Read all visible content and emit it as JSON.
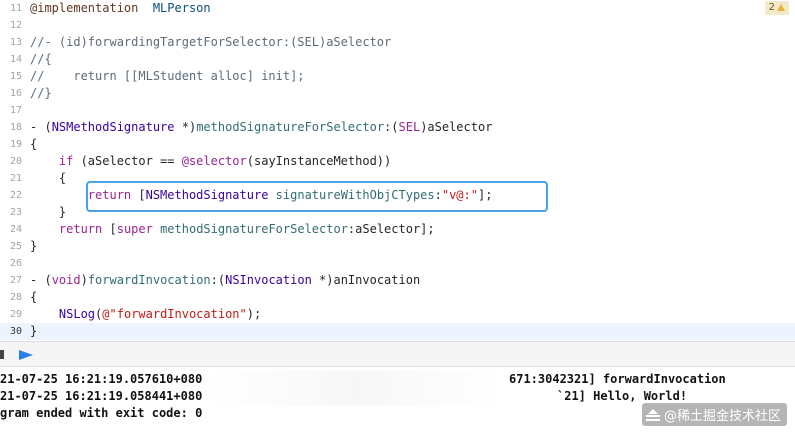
{
  "editor": {
    "issue_badge": "2",
    "lines": [
      {
        "num": "11",
        "tokens": [
          [
            "dir",
            "@implementation"
          ],
          [
            "",
            ""
          ],
          [
            "",
            "  "
          ],
          [
            "cls",
            "MLPerson"
          ]
        ]
      },
      {
        "num": "12",
        "tokens": []
      },
      {
        "num": "13",
        "tokens": [
          [
            "cmt",
            "//- (id)forwardingTargetForSelector:(SEL)aSelector"
          ]
        ]
      },
      {
        "num": "14",
        "tokens": [
          [
            "cmt",
            "//{"
          ]
        ]
      },
      {
        "num": "15",
        "tokens": [
          [
            "cmt",
            "//    return [[MLStudent alloc] init];"
          ]
        ]
      },
      {
        "num": "16",
        "tokens": [
          [
            "cmt",
            "//}"
          ]
        ]
      },
      {
        "num": "17",
        "tokens": []
      },
      {
        "num": "18",
        "tokens": [
          [
            "",
            "- ("
          ],
          [
            "ty",
            "NSMethodSignature"
          ],
          [
            "",
            " *)"
          ],
          [
            "fn",
            "methodSignatureForSelector"
          ],
          [
            "",
            ":("
          ],
          [
            "kw",
            "SEL"
          ],
          [
            "",
            ")aSelector"
          ]
        ]
      },
      {
        "num": "19",
        "tokens": [
          [
            "",
            "{"
          ]
        ]
      },
      {
        "num": "20",
        "tokens": [
          [
            "",
            "    "
          ],
          [
            "kw",
            "if"
          ],
          [
            "",
            " (aSelector == "
          ],
          [
            "kw",
            "@selector"
          ],
          [
            "",
            "(sayInstanceMethod))"
          ]
        ]
      },
      {
        "num": "21",
        "tokens": [
          [
            "",
            "    {"
          ]
        ]
      },
      {
        "num": "22",
        "tokens": [
          [
            "",
            "        "
          ],
          [
            "kw",
            "return"
          ],
          [
            "",
            " ["
          ],
          [
            "ty",
            "NSMethodSignature"
          ],
          [
            "",
            " "
          ],
          [
            "fn",
            "signatureWithObjCTypes"
          ],
          [
            "",
            ":"
          ],
          [
            "str",
            "\"v@:\""
          ],
          [
            "",
            "];"
          ]
        ]
      },
      {
        "num": "23",
        "tokens": [
          [
            "",
            "    }"
          ]
        ]
      },
      {
        "num": "24",
        "tokens": [
          [
            "",
            "    "
          ],
          [
            "kw",
            "return"
          ],
          [
            "",
            " ["
          ],
          [
            "kw",
            "super"
          ],
          [
            "",
            " "
          ],
          [
            "fn",
            "methodSignatureForSelector"
          ],
          [
            "",
            ":aSelector];"
          ]
        ]
      },
      {
        "num": "25",
        "tokens": [
          [
            "",
            "}"
          ]
        ]
      },
      {
        "num": "26",
        "tokens": []
      },
      {
        "num": "27",
        "tokens": [
          [
            "",
            "- ("
          ],
          [
            "kw",
            "void"
          ],
          [
            "",
            ")"
          ],
          [
            "fn",
            "forwardInvocation"
          ],
          [
            "",
            ":("
          ],
          [
            "ty",
            "NSInvocation"
          ],
          [
            "",
            " *)anInvocation"
          ]
        ]
      },
      {
        "num": "28",
        "tokens": [
          [
            "",
            "{"
          ]
        ]
      },
      {
        "num": "29",
        "tokens": [
          [
            "",
            "    "
          ],
          [
            "ty",
            "NSLog"
          ],
          [
            "",
            "("
          ],
          [
            "str",
            "@\"forwardInvocation\""
          ],
          [
            "",
            ");"
          ]
        ]
      },
      {
        "num": "30",
        "tokens": [
          [
            "",
            "}"
          ]
        ]
      }
    ],
    "current_line": "30"
  },
  "console": {
    "lines": [
      {
        "left": "21-07-25 16:21:19.057610+080",
        "right": "671:3042321] forwardInvocation"
      },
      {
        "left": "21-07-25 16:21:19.058441+080",
        "right": "`21] Hello, World!"
      },
      {
        "left": "gram ended with exit code: 0",
        "right": ""
      }
    ]
  },
  "watermark": {
    "text": "@稀土掘金技术社区"
  }
}
